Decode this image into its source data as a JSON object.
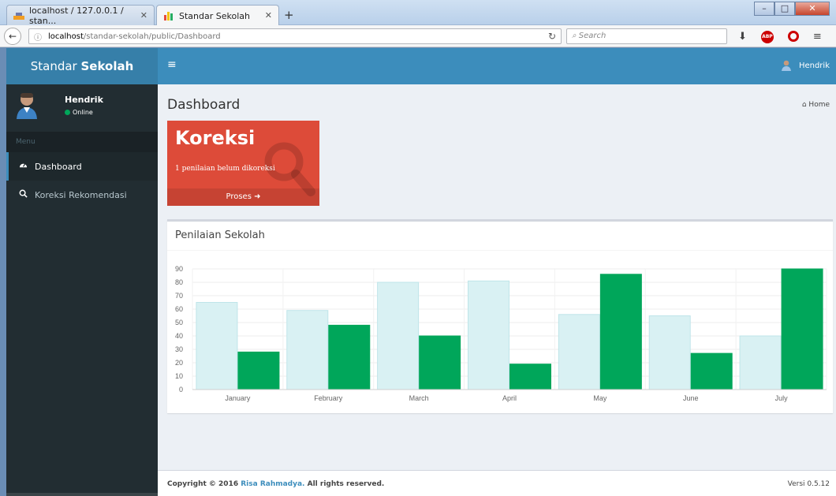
{
  "browser": {
    "tabs": [
      {
        "label": "localhost / 127.0.0.1 / stan..."
      },
      {
        "label": "Standar Sekolah"
      }
    ],
    "url_host": "localhost",
    "url_path": "/standar-sekolah/public/Dashboard",
    "search_placeholder": "Search",
    "abp_label": "ABP"
  },
  "brand": {
    "light": "Standar",
    "bold": "Sekolah"
  },
  "user": {
    "name": "Hendrik",
    "status": "Online"
  },
  "sidebar": {
    "header": "Menu",
    "items": [
      {
        "label": "Dashboard",
        "icon": "dashboard-icon",
        "active": true
      },
      {
        "label": "Koreksi Rekomendasi",
        "icon": "search-icon",
        "active": false
      }
    ]
  },
  "content_header": {
    "title": "Dashboard",
    "breadcrumb": "Home"
  },
  "info_box": {
    "title": "Koreksi",
    "text": "1 penilaian belum dikoreksi",
    "footer": "Proses",
    "color": "#dd4b39"
  },
  "panel": {
    "title": "Penilaian Sekolah"
  },
  "chart_data": {
    "type": "bar",
    "categories": [
      "January",
      "February",
      "March",
      "April",
      "May",
      "June",
      "July"
    ],
    "series": [
      {
        "values": [
          65,
          59,
          80,
          81,
          56,
          55,
          40
        ],
        "color": "#d9f1f3"
      },
      {
        "values": [
          28,
          48,
          40,
          19,
          86,
          27,
          90
        ],
        "color": "#00a65a"
      }
    ],
    "ylim": [
      0,
      90
    ],
    "yticks": [
      0,
      10,
      20,
      30,
      40,
      50,
      60,
      70,
      80,
      90
    ],
    "grid": true
  },
  "footer": {
    "copyright_prefix": "Copyright © 2016 ",
    "author": "Risa Rahmadya.",
    "suffix": " All rights reserved.",
    "version": "Versi 0.5.12"
  }
}
